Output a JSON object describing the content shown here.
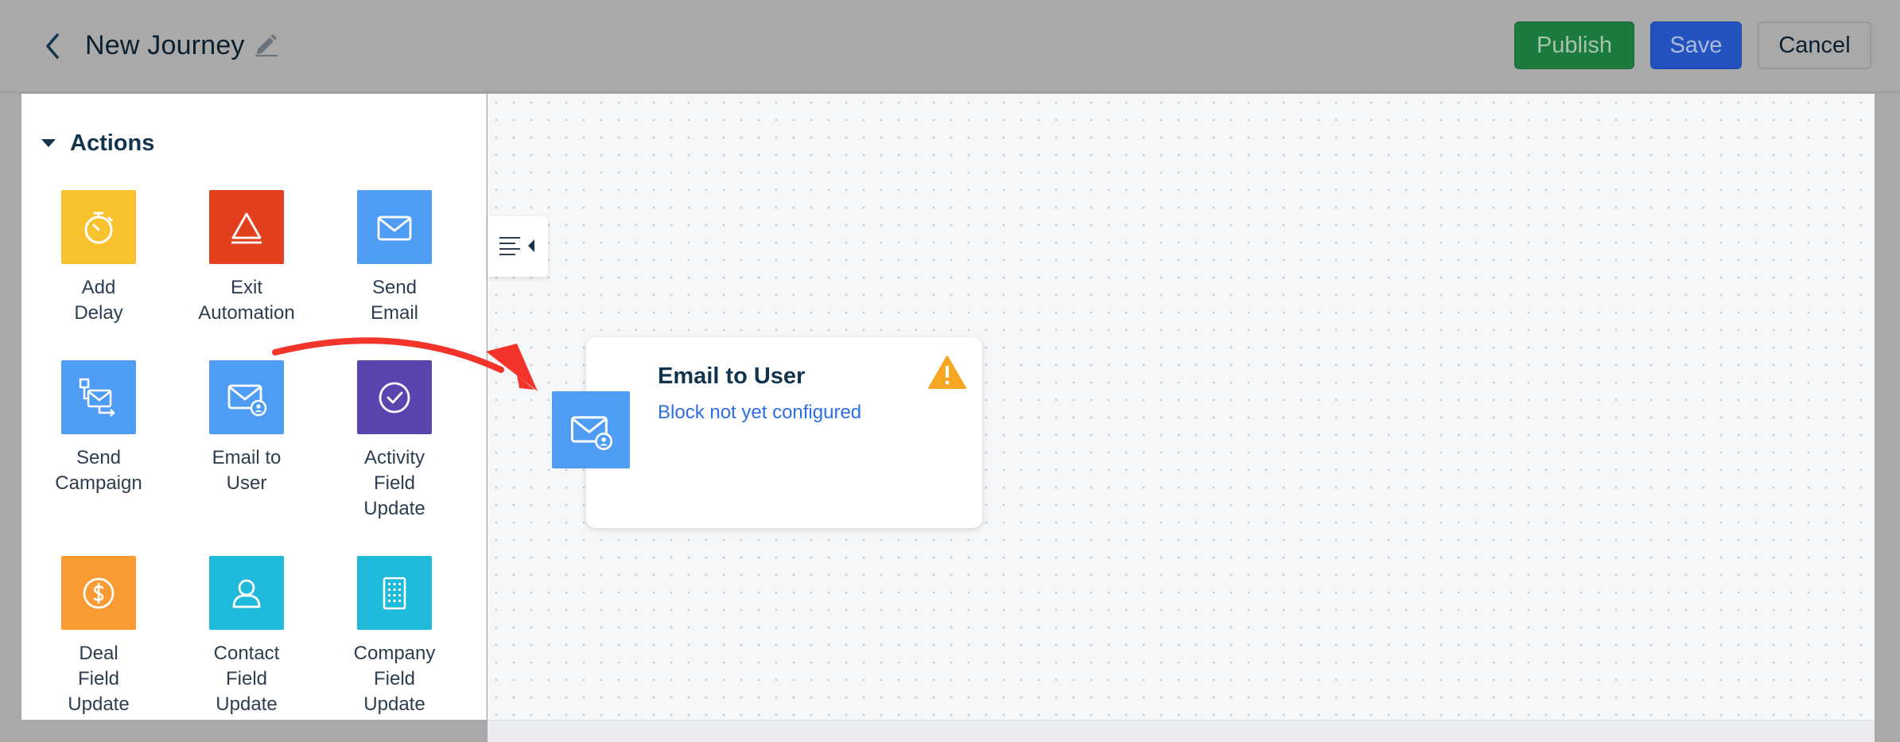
{
  "header": {
    "title": "New Journey",
    "buttons": {
      "publish": "Publish",
      "save": "Save",
      "cancel": "Cancel"
    }
  },
  "sidebar": {
    "section_title": "Actions",
    "tiles": [
      {
        "label": "Add\nDelay",
        "icon": "stopwatch-icon",
        "color": "#f8c22e"
      },
      {
        "label": "Exit\nAutomation",
        "icon": "exit-triangle-icon",
        "color": "#e2401f"
      },
      {
        "label": "Send\nEmail",
        "icon": "envelope-icon",
        "color": "#4f9cf5"
      },
      {
        "label": "Send\nCampaign",
        "icon": "campaign-icon",
        "color": "#4f9cf5"
      },
      {
        "label": "Email to\nUser",
        "icon": "envelope-user-icon",
        "color": "#4f9cf5"
      },
      {
        "label": "Activity\nField\nUpdate",
        "icon": "check-circle-icon",
        "color": "#5a44ae"
      },
      {
        "label": "Deal\nField\nUpdate",
        "icon": "dollar-icon",
        "color": "#f99a33"
      },
      {
        "label": "Contact\nField\nUpdate",
        "icon": "person-icon",
        "color": "#1fb9d9"
      },
      {
        "label": "Company\nField\nUpdate",
        "icon": "building-icon",
        "color": "#1fb9d9"
      }
    ]
  },
  "canvas": {
    "block": {
      "title": "Email to User",
      "subtitle": "Block not yet configured",
      "icon": "envelope-user-icon",
      "status_icon": "warning-icon",
      "color": "#4f9cf5"
    }
  },
  "colors": {
    "publish": "#1b7a3e",
    "save": "#2452bf",
    "arrow": "#f2342a",
    "warning": "#f5a623"
  }
}
